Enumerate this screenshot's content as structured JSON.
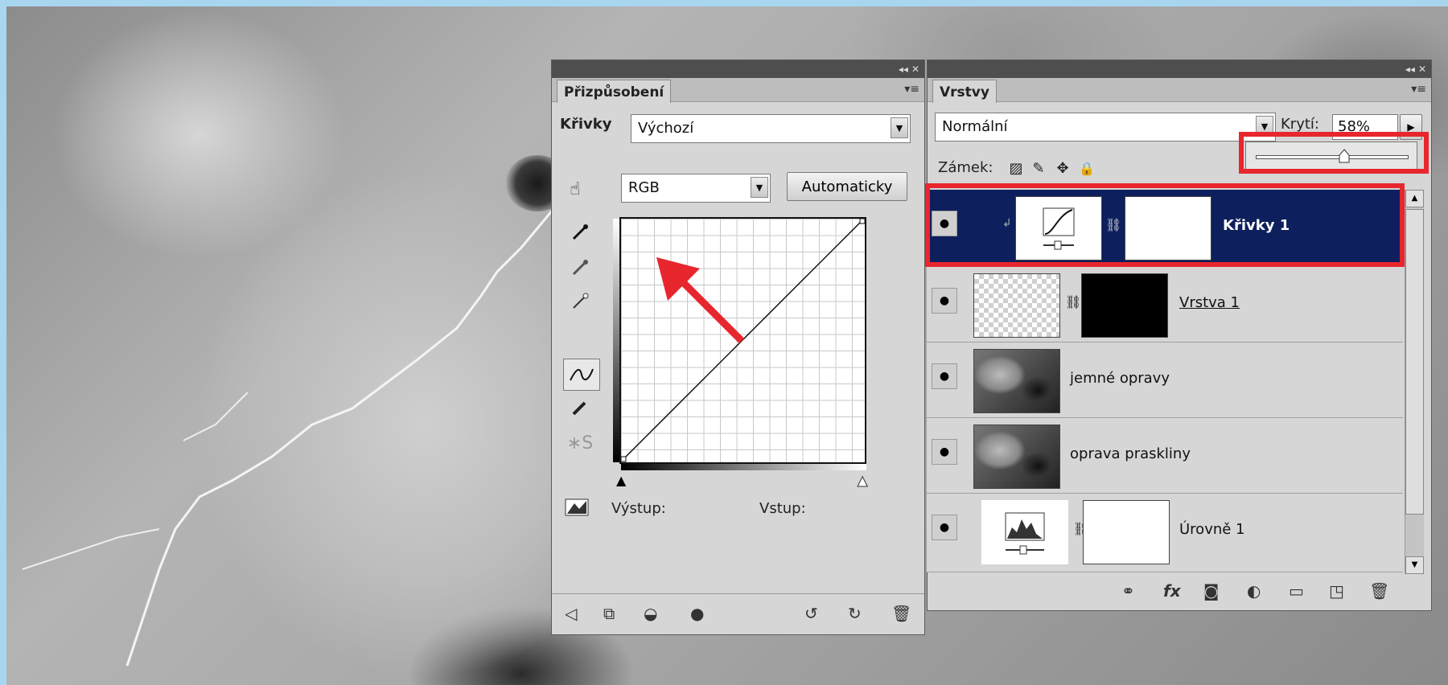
{
  "adjustments_panel": {
    "tab": "Přizpůsobení",
    "preset_label": "Křivky",
    "preset_value": "Výchozí",
    "channel": "RGB",
    "auto_button": "Automaticky",
    "output_label": "Výstup:",
    "input_label": "Vstup:"
  },
  "layers_panel": {
    "tab": "Vrstvy",
    "blend_mode": "Normální",
    "opacity_label": "Krytí:",
    "opacity_value": "58%",
    "opacity_fraction": 0.58,
    "lock_label": "Zámek:",
    "layers": [
      {
        "name": "Křivky 1",
        "selected": true
      },
      {
        "name": "Vrstva 1"
      },
      {
        "name": "jemné opravy"
      },
      {
        "name": "oprava praskliny"
      },
      {
        "name": "Úrovně 1"
      }
    ]
  },
  "colors": {
    "highlight": "#e8262e",
    "selected_layer": "#0d1f5c",
    "background": "#a9d6ef"
  }
}
